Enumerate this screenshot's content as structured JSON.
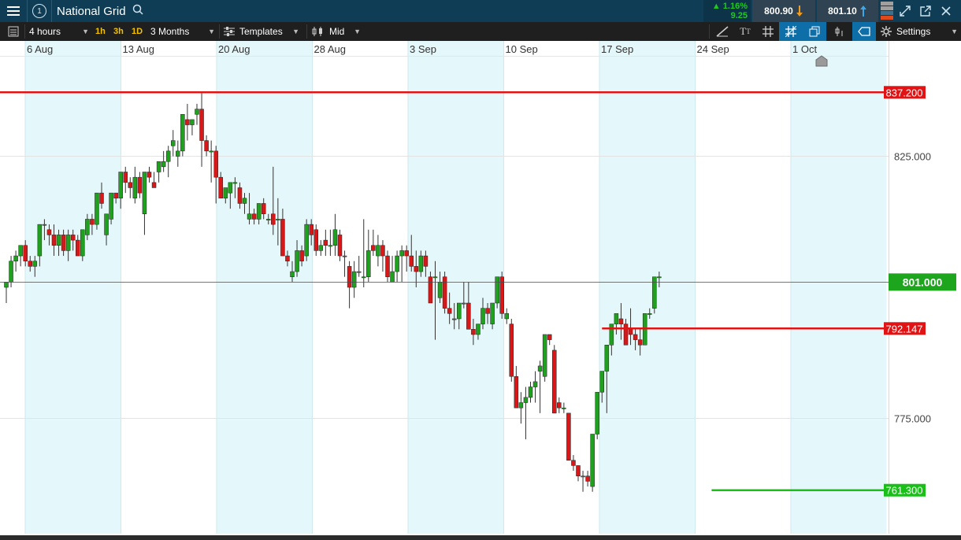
{
  "header": {
    "menu_icon": "hamburger-icon",
    "badge": "1",
    "instrument": "National Grid",
    "search_icon": "search-icon",
    "change_pct": "▲ 1.16%",
    "change_abs": "9.25",
    "sell_price": "800.90",
    "buy_price": "801.10",
    "sell_icon": "arrow-down-icon",
    "buy_icon": "arrow-up-icon"
  },
  "toolbar": {
    "interval": "4 hours",
    "quick_1h": "1h",
    "quick_3h": "3h",
    "quick_1d": "1D",
    "range": "3 Months",
    "templates": "Templates",
    "price_type": "Mid",
    "settings": "Settings"
  },
  "colors": {
    "up": "#1fa01f",
    "down": "#d81818",
    "band": "#e4f8fb",
    "support": "#18c018",
    "resistance": "#e01414"
  },
  "chart_data": {
    "type": "candlestick",
    "ylim": [
      753,
      844
    ],
    "y_ticks": [
      {
        "value": 825,
        "label": "825.000"
      },
      {
        "value": 775,
        "label": "775.000"
      }
    ],
    "x_ticks": [
      "6 Aug",
      "13 Aug",
      "20 Aug",
      "28 Aug",
      "3 Sep",
      "10 Sep",
      "17 Sep",
      "24 Sep",
      "1 Oct"
    ],
    "levels": [
      {
        "value": 837.2,
        "label": "837.200",
        "kind": "resistance",
        "from": 0
      },
      {
        "value": 792.147,
        "label": "792.147",
        "kind": "resistance",
        "from": 125
      },
      {
        "value": 761.3,
        "label": "761.300",
        "kind": "support",
        "from": 148
      }
    ],
    "current_price": {
      "value": 801.0,
      "label": "801.000"
    },
    "candles": [
      [
        800,
        801,
        797,
        801
      ],
      [
        801,
        806,
        800,
        805
      ],
      [
        805,
        807,
        803,
        806
      ],
      [
        806,
        808,
        804,
        808
      ],
      [
        808,
        809,
        804,
        805
      ],
      [
        805,
        806,
        803,
        804
      ],
      [
        804,
        806,
        802,
        805
      ],
      [
        806,
        812,
        804,
        812
      ],
      [
        812,
        813,
        809,
        812
      ],
      [
        811,
        812,
        808,
        810
      ],
      [
        810,
        812,
        806,
        808
      ],
      [
        808,
        811,
        806,
        810
      ],
      [
        810,
        811,
        806,
        807
      ],
      [
        807,
        811,
        805,
        810
      ],
      [
        810,
        811,
        807,
        809
      ],
      [
        809,
        810,
        806,
        806
      ],
      [
        806,
        811,
        805,
        811
      ],
      [
        810,
        814,
        809,
        813
      ],
      [
        813,
        814,
        810,
        812
      ],
      [
        812,
        818,
        811,
        818
      ],
      [
        818,
        820,
        815,
        816
      ],
      [
        810,
        814,
        808,
        814
      ],
      [
        813,
        818,
        812,
        818
      ],
      [
        818,
        818,
        816,
        817
      ],
      [
        817,
        822,
        815,
        822
      ],
      [
        822,
        823,
        818,
        820
      ],
      [
        820,
        821,
        817,
        819
      ],
      [
        817,
        823,
        816,
        821
      ],
      [
        821,
        822,
        817,
        818
      ],
      [
        814,
        822,
        810,
        822
      ],
      [
        822,
        823,
        820,
        821
      ],
      [
        820,
        822,
        819,
        819
      ],
      [
        822,
        824,
        820,
        824
      ],
      [
        823,
        826,
        822,
        824
      ],
      [
        824,
        827,
        821,
        826
      ],
      [
        827,
        830,
        825,
        828
      ],
      [
        825,
        828,
        823,
        826
      ],
      [
        826,
        833,
        825,
        833
      ],
      [
        832,
        835,
        828,
        831
      ],
      [
        831,
        832,
        829,
        832
      ],
      [
        833,
        835,
        831,
        834
      ],
      [
        834,
        837,
        823,
        828
      ],
      [
        828,
        829,
        825,
        826
      ],
      [
        826,
        828,
        820,
        826
      ],
      [
        826,
        827,
        816,
        821
      ],
      [
        821,
        822,
        817,
        817
      ],
      [
        817,
        819,
        816,
        819
      ],
      [
        818,
        820,
        815,
        820
      ],
      [
        820,
        821,
        817,
        820
      ],
      [
        819,
        820,
        815,
        816
      ],
      [
        816,
        818,
        814,
        817
      ],
      [
        813,
        818,
        812,
        814
      ],
      [
        814,
        815,
        812,
        813
      ],
      [
        813,
        816,
        812,
        816
      ],
      [
        816,
        817,
        813,
        814
      ],
      [
        813,
        814,
        812,
        813
      ],
      [
        814,
        823,
        810,
        812
      ],
      [
        813,
        817,
        808,
        813
      ],
      [
        813,
        815,
        806,
        806
      ],
      [
        806,
        807,
        804,
        805
      ],
      [
        802,
        805,
        801,
        803
      ],
      [
        803,
        809,
        802,
        807
      ],
      [
        807,
        808,
        804,
        805
      ],
      [
        806,
        813,
        805,
        812
      ],
      [
        812,
        813,
        808,
        810
      ],
      [
        811,
        812,
        806,
        807
      ],
      [
        807,
        809,
        806,
        808
      ],
      [
        809,
        811,
        806,
        808
      ],
      [
        808,
        811,
        806,
        808
      ],
      [
        808,
        814,
        806,
        811
      ],
      [
        810,
        811,
        805,
        806
      ],
      [
        806,
        807,
        802,
        806
      ],
      [
        804,
        805,
        796,
        800
      ],
      [
        800,
        805,
        798,
        803
      ],
      [
        803,
        806,
        802,
        803
      ],
      [
        802,
        813,
        800,
        802
      ],
      [
        802,
        811,
        801,
        807
      ],
      [
        808,
        811,
        806,
        807
      ],
      [
        806,
        810,
        804,
        808
      ],
      [
        808,
        809,
        803,
        806
      ],
      [
        806,
        807,
        801,
        802
      ],
      [
        801,
        806,
        802,
        803
      ],
      [
        803,
        807,
        801,
        806
      ],
      [
        806,
        808,
        801,
        807
      ],
      [
        807,
        808,
        803,
        806
      ],
      [
        806,
        810,
        803,
        804
      ],
      [
        804,
        807,
        800,
        803
      ],
      [
        803,
        807,
        802,
        806
      ],
      [
        806,
        807,
        802,
        804
      ],
      [
        802,
        803,
        797,
        797
      ],
      [
        802,
        805,
        790,
        802
      ],
      [
        798,
        803,
        797,
        801
      ],
      [
        802,
        803,
        795,
        796
      ],
      [
        796,
        799,
        793,
        795
      ],
      [
        794,
        797,
        792,
        794
      ],
      [
        794,
        797,
        792,
        797
      ],
      [
        797,
        801,
        796,
        797
      ],
      [
        797,
        801,
        792,
        792
      ],
      [
        792,
        794,
        789,
        791
      ],
      [
        791,
        793,
        790,
        793
      ],
      [
        793,
        798,
        792,
        796
      ],
      [
        796,
        797,
        793,
        795
      ],
      [
        793,
        796,
        792,
        797
      ],
      [
        797,
        802,
        796,
        802
      ],
      [
        802,
        803,
        794,
        795
      ],
      [
        794,
        796,
        793,
        795
      ],
      [
        793,
        794,
        782,
        783
      ],
      [
        783,
        785,
        777,
        777
      ],
      [
        777,
        780,
        774,
        778
      ],
      [
        778,
        781,
        771,
        779
      ],
      [
        779,
        782,
        778,
        781
      ],
      [
        781,
        784,
        778,
        782
      ],
      [
        784,
        786,
        776,
        785
      ],
      [
        783,
        791,
        782,
        791
      ],
      [
        791,
        791,
        789,
        790
      ],
      [
        788,
        789,
        781,
        776
      ],
      [
        778,
        779,
        776,
        777
      ],
      [
        777,
        778,
        776,
        777
      ],
      [
        776,
        776,
        767,
        767
      ],
      [
        767,
        768,
        765,
        766
      ],
      [
        766,
        766,
        763,
        764
      ],
      [
        764,
        765,
        761,
        764
      ],
      [
        764,
        765,
        762,
        763
      ],
      [
        762,
        772,
        761,
        772
      ],
      [
        772,
        780,
        771,
        780
      ],
      [
        780,
        784,
        778,
        784
      ],
      [
        784,
        789,
        776,
        789
      ],
      [
        789,
        793,
        787,
        793
      ],
      [
        793,
        795,
        791,
        795
      ],
      [
        794,
        797,
        790,
        793
      ],
      [
        793,
        794,
        789,
        789
      ],
      [
        792,
        796,
        789,
        791
      ],
      [
        791,
        792,
        788,
        790
      ],
      [
        790,
        792,
        787,
        789
      ],
      [
        789,
        795,
        789,
        795
      ],
      [
        795,
        796,
        794,
        795
      ],
      [
        796,
        802,
        795,
        802
      ],
      [
        802,
        803,
        800,
        802
      ]
    ]
  }
}
